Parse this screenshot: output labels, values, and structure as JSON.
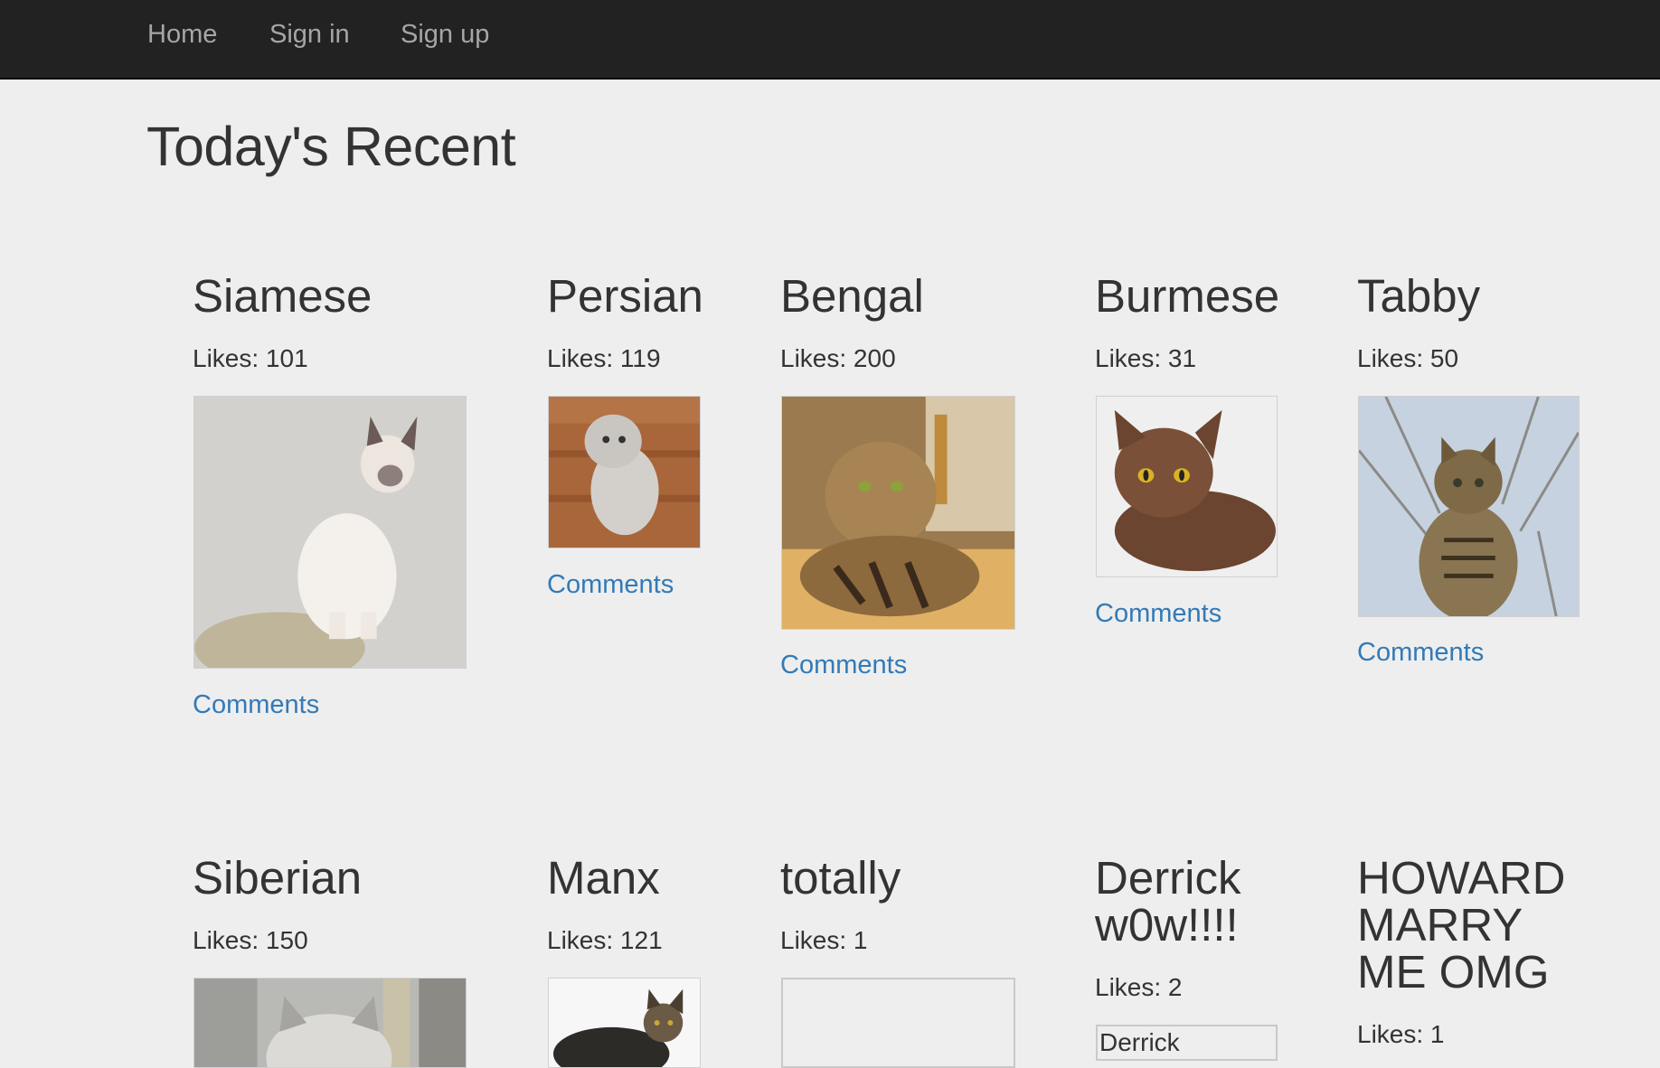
{
  "nav": {
    "home": "Home",
    "sign_in": "Sign in",
    "sign_up": "Sign up"
  },
  "page": {
    "title": "Today's Recent"
  },
  "cats": [
    {
      "name": "Siamese",
      "likes": "Likes: 101",
      "image": "siamese-cat-photo",
      "comments": "Comments"
    },
    {
      "name": "Persian",
      "likes": "Likes: 119",
      "image": "persian-cat-photo",
      "comments": "Comments"
    },
    {
      "name": "Bengal",
      "likes": "Likes: 200",
      "image": "bengal-cat-photo",
      "comments": "Comments"
    },
    {
      "name": "Burmese",
      "likes": "Likes: 31",
      "image": "burmese-cat-photo",
      "comments": "Comments"
    },
    {
      "name": "Tabby",
      "likes": "Likes: 50",
      "image": "tabby-cat-photo",
      "comments": "Comments"
    },
    {
      "name": "Siberian",
      "likes": "Likes: 150",
      "image": "siberian-cat-photo"
    },
    {
      "name": "Manx",
      "likes": "Likes: 121",
      "image": "manx-cat-photo"
    },
    {
      "name": "totally",
      "likes": "Likes: 1",
      "image": "broken-image"
    },
    {
      "name_line1": "Derrick",
      "name_line2": "w0w!!!!",
      "likes": "Likes: 2",
      "image_alt": "Derrick"
    },
    {
      "name_line1": "HOWARD",
      "name_line2": "MARRY",
      "name_line3": "ME OMG",
      "likes": "Likes: 1"
    }
  ],
  "colors": {
    "navbar": "#222222",
    "nav_text": "#a6a6a6",
    "background": "#eeeeee",
    "link": "#337ab7",
    "text": "#333333"
  }
}
